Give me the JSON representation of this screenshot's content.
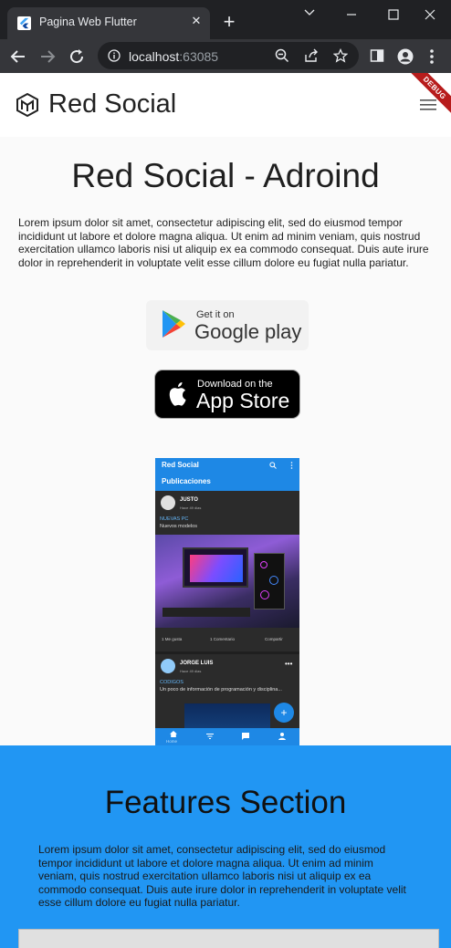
{
  "browser": {
    "tab_title": "Pagina Web Flutter",
    "url_host": "localhost",
    "url_port": ":63085"
  },
  "appbar": {
    "brand": "Red Social",
    "debug_label": "DEBUG"
  },
  "hero": {
    "title": "Red Social - Adroind",
    "text": "Lorem ipsum dolor sit amet, consectetur adipiscing elit, sed do eiusmod tempor incididunt ut labore et dolore magna aliqua. Ut enim ad minim veniam, quis nostrud exercitation ullamco laboris nisi ut aliquip ex ea commodo consequat. Duis aute irure dolor in reprehenderit in voluptate velit esse cillum dolore eu fugiat nulla pariatur."
  },
  "google_play": {
    "small": "Get it on",
    "big": "Google play"
  },
  "app_store": {
    "small": "Download on the",
    "big": "App Store"
  },
  "phone": {
    "app_title": "Red Social",
    "tab": "Publicaciones",
    "post1": {
      "author": "JUSTO",
      "meta": "Hace 49 dias",
      "category": "NUEVAS PC",
      "description": "Nuevos modelos"
    },
    "actions": [
      "1 Me gusta",
      "1 Comentario",
      "Compartir"
    ],
    "post2": {
      "author": "JORGE LUIS",
      "meta": "Hace 49 dias",
      "category": "CODIGOS",
      "description": "Un poco de información de programación y disciplina..."
    },
    "nav_home": "Home"
  },
  "features": {
    "title": "Features Section",
    "text": "Lorem ipsum dolor sit amet, consectetur adipiscing elit, sed do eiusmod tempor incididunt ut labore et dolore magna aliqua. Ut enim ad minim veniam, quis nostrud exercitation ullamco laboris nisi ut aliquip ex ea commodo consequat. Duis aute irure dolor in reprehenderit in voluptate velit esse cillum dolore eu fugiat nulla pariatur."
  }
}
